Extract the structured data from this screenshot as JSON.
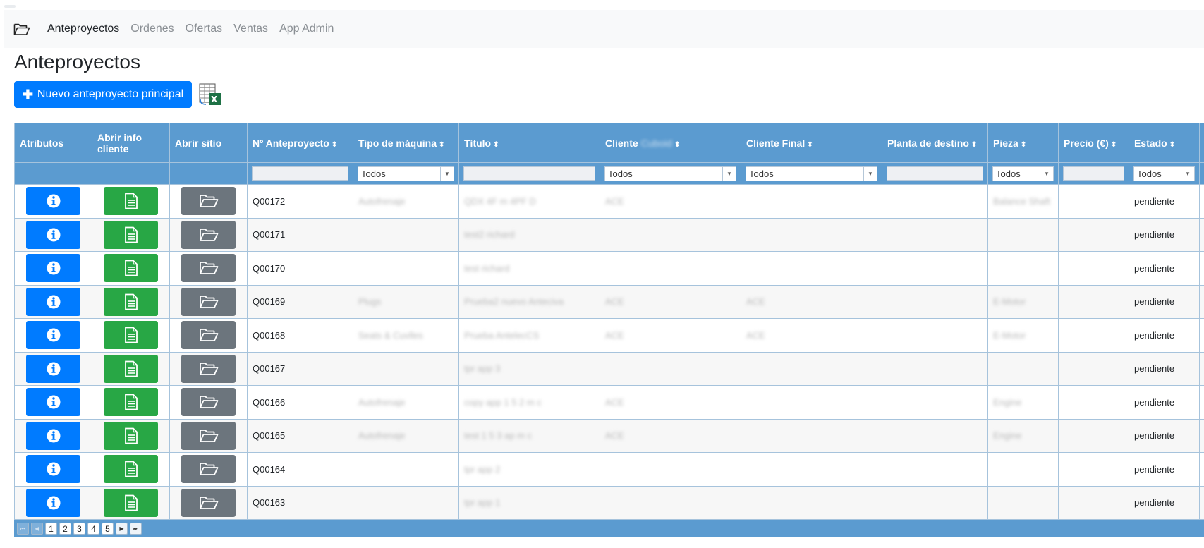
{
  "colors": {
    "primary": "#007bff",
    "success": "#28a745",
    "secondary": "#6c757d",
    "table_header": "#5b9bd0"
  },
  "nav": {
    "brand_icon": "folder-open-icon",
    "links": [
      {
        "label": "Anteproyectos",
        "active": true
      },
      {
        "label": "Ordenes",
        "active": false
      },
      {
        "label": "Ofertas",
        "active": false
      },
      {
        "label": "Ventas",
        "active": false
      },
      {
        "label": "App Admin",
        "active": false
      }
    ]
  },
  "page": {
    "title": "Anteproyectos",
    "new_button": "Nuevo anteproyecto principal",
    "export_icon": "excel-export-icon"
  },
  "table": {
    "columns": [
      "Atributos",
      "Abrir info cliente",
      "Abrir sitio",
      "Nº Anteproyecto",
      "Tipo de máquina",
      "Título",
      "Cliente",
      "Cliente Final",
      "Planta de destino",
      "Pieza",
      "Precio (€)",
      "Estado"
    ],
    "filters": {
      "select_default": "Todos"
    },
    "rows": [
      {
        "id": "Q00172",
        "tipo": "Autofrenaje",
        "titulo": "QDX 4F m 4PF D",
        "cliente": "ACE",
        "cliente_final": "",
        "planta": "",
        "pieza": "Balance Shaft",
        "precio": "",
        "estado": "pendiente"
      },
      {
        "id": "Q00171",
        "tipo": "",
        "titulo": "test2 richard",
        "cliente": "",
        "cliente_final": "",
        "planta": "",
        "pieza": "",
        "precio": "",
        "estado": "pendiente"
      },
      {
        "id": "Q00170",
        "tipo": "",
        "titulo": "test richard",
        "cliente": "",
        "cliente_final": "",
        "planta": "",
        "pieza": "",
        "precio": "",
        "estado": "pendiente"
      },
      {
        "id": "Q00169",
        "tipo": "Plugs",
        "titulo": "Prueba2 nuevo Anteciva",
        "cliente": "ACE",
        "cliente_final": "ACE",
        "planta": "",
        "pieza": "E-Motor",
        "precio": "",
        "estado": "pendiente"
      },
      {
        "id": "Q00168",
        "tipo": "Seats & Cuvlles",
        "titulo": "Prueba AntelecCS",
        "cliente": "ACE",
        "cliente_final": "ACE",
        "planta": "",
        "pieza": "E-Motor",
        "precio": "",
        "estado": "pendiente"
      },
      {
        "id": "Q00167",
        "tipo": "",
        "titulo": "tpr app 3",
        "cliente": "",
        "cliente_final": "",
        "planta": "",
        "pieza": "",
        "precio": "",
        "estado": "pendiente"
      },
      {
        "id": "Q00166",
        "tipo": "Autofrenaje",
        "titulo": "copy app 1 5 2 m c",
        "cliente": "ACE",
        "cliente_final": "",
        "planta": "",
        "pieza": "Engine",
        "precio": "",
        "estado": "pendiente"
      },
      {
        "id": "Q00165",
        "tipo": "Autofrenaje",
        "titulo": "test 1 5 3 ap m c",
        "cliente": "ACE",
        "cliente_final": "",
        "planta": "",
        "pieza": "Engine",
        "precio": "",
        "estado": "pendiente"
      },
      {
        "id": "Q00164",
        "tipo": "",
        "titulo": "tpr app 2",
        "cliente": "",
        "cliente_final": "",
        "planta": "",
        "pieza": "",
        "precio": "",
        "estado": "pendiente"
      },
      {
        "id": "Q00163",
        "tipo": "",
        "titulo": "tpr app 1",
        "cliente": "",
        "cliente_final": "",
        "planta": "",
        "pieza": "",
        "precio": "",
        "estado": "pendiente"
      }
    ]
  },
  "pager": {
    "pages": [
      "1",
      "2",
      "3",
      "4",
      "5"
    ],
    "current": "1"
  }
}
